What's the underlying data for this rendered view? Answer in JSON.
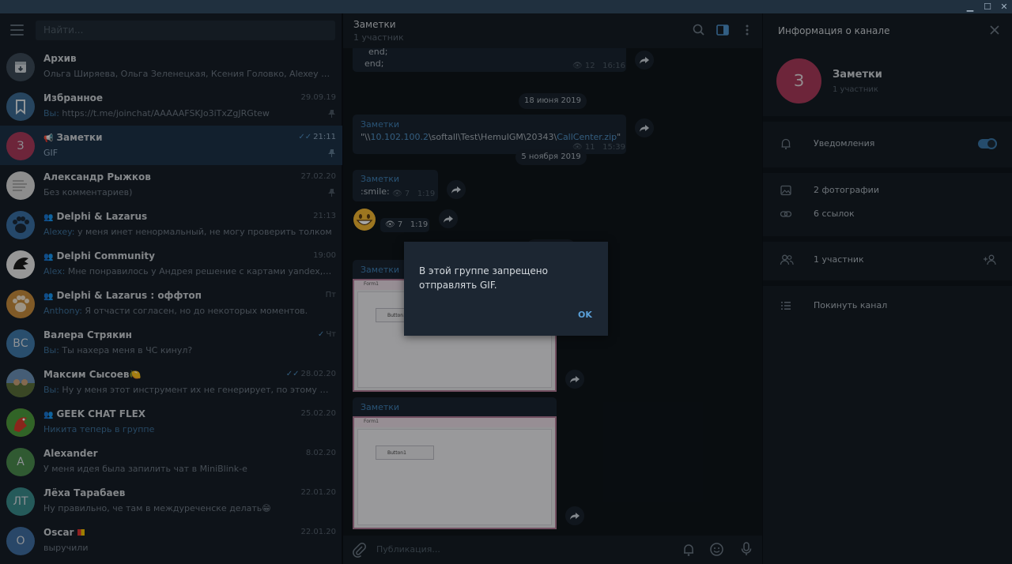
{
  "window": {
    "min": "▁",
    "max": "☐",
    "close": "✕"
  },
  "sidebar": {
    "search_placeholder": "Найти...",
    "chats": [
      {
        "name": "Архив",
        "preview": "Ольга Ширяева, Ольга Зеленецкая, Ксения Головко, Alexey Kostyuchenk...",
        "time": "",
        "avatar_text": "",
        "color": "#3d4b58"
      },
      {
        "name": "Избранное",
        "who": "Вы:",
        "preview": " https://t.me/joinchat/AAAAAFSKJo3iTxZgJRGtew",
        "time": "29.09.19",
        "avatar_text": "",
        "color": "#3c6b93"
      },
      {
        "name": "Заметки",
        "preview": "GIF",
        "time": "21:11",
        "avatar_text": "З",
        "color": "#a83a5a"
      },
      {
        "name": "Александр Рыжков",
        "preview": "Без комментариев)",
        "time": "27.02.20",
        "avatar_text": "",
        "color": "#d9d9d9"
      },
      {
        "name": "Delphi & Lazarus",
        "who": "Alexey:",
        "preview": " у меня инет ненормальный, не могу проверить толком",
        "time": "21:13",
        "avatar_text": "",
        "color": "#3a6fa4"
      },
      {
        "name": "Delphi Community",
        "who": "Alex:",
        "preview": " Мне понравилось у Андрея решение с картами yandex, google, ос...",
        "time": "19:00",
        "avatar_text": "",
        "color": "#e8e8e8"
      },
      {
        "name": "Delphi & Lazarus : оффтоп",
        "who": "Anthony:",
        "preview": " Я отчасти согласен, но до некоторых моментов.",
        "time": "Пт",
        "avatar_text": "",
        "color": "#c58a3c"
      },
      {
        "name": "Валера Стрякин",
        "who": "Вы:",
        "preview": " Ты нахера меня в ЧС кинул?",
        "time": "Чт",
        "avatar_text": "ВС",
        "color": "#3f78a8"
      },
      {
        "name": "Максим Сысоев",
        "who": "Вы:",
        "preview": " Ну у меня этот инструмент их не генерирует, по этому и без них)",
        "time": "28.02.20",
        "avatar_text": "",
        "color": "#4a7c59"
      },
      {
        "name": "GEEK CHAT FLEX",
        "preview": "Никита теперь в группе",
        "time": "25.02.20",
        "avatar_text": "",
        "color": "#b83a3a"
      },
      {
        "name": "Alexander",
        "preview": "У меня идея была запилить чат в MiniBlink-е",
        "time": "8.02.20",
        "avatar_text": "A",
        "color": "#4b8a4e"
      },
      {
        "name": "Лёха Тарабаев",
        "preview": "Ну правильно, че там в междуреченске делать😁",
        "time": "22.01.20",
        "avatar_text": "ЛТ",
        "color": "#3a8a8a"
      },
      {
        "name": "Oscar",
        "preview": "выручили",
        "time": "22.01.20",
        "avatar_text": "O",
        "color": "#3f6ea0"
      }
    ]
  },
  "chat": {
    "title": "Заметки",
    "subtitle": "1 участник",
    "msg0_line1": "end;",
    "msg0_line2": "end;",
    "msg0_views": "12",
    "msg0_time": "16:16",
    "date1": "18 июня 2019",
    "msg1_title": "Заметки",
    "msg1_text_pre": "\"\\\\",
    "msg1_ip": "10.102.100.2",
    "msg1_path": "\\softall\\Test\\HemulGM\\20343\\",
    "msg1_file": "CallCenter.zip",
    "msg1_text_post": "\"",
    "msg1_views": "11",
    "msg1_time": "15:39",
    "date2": "5 ноября 2019",
    "msg2_title": "Заметки",
    "msg2_text": ":smile:",
    "msg2_views": "7",
    "msg2_time": "1:19",
    "msg3_views": "7",
    "msg3_time": "1:19",
    "msg4_title": "Заметки",
    "msg5_title": "Заметки",
    "gif_window_title": "Form1",
    "gif_button_label": "Button1",
    "compose_placeholder": "Публикация..."
  },
  "info": {
    "title": "Информация о канале",
    "name": "Заметки",
    "avatar_text": "З",
    "subtitle": "1 участник",
    "notifications": "Уведомления",
    "notifications_on": true,
    "photos": "2 фотографии",
    "links": "6 ссылок",
    "members": "1 участник",
    "leave": "Покинуть канал"
  },
  "dialog": {
    "text": "В этой группе запрещено отправлять GIF.",
    "ok": "OK"
  }
}
